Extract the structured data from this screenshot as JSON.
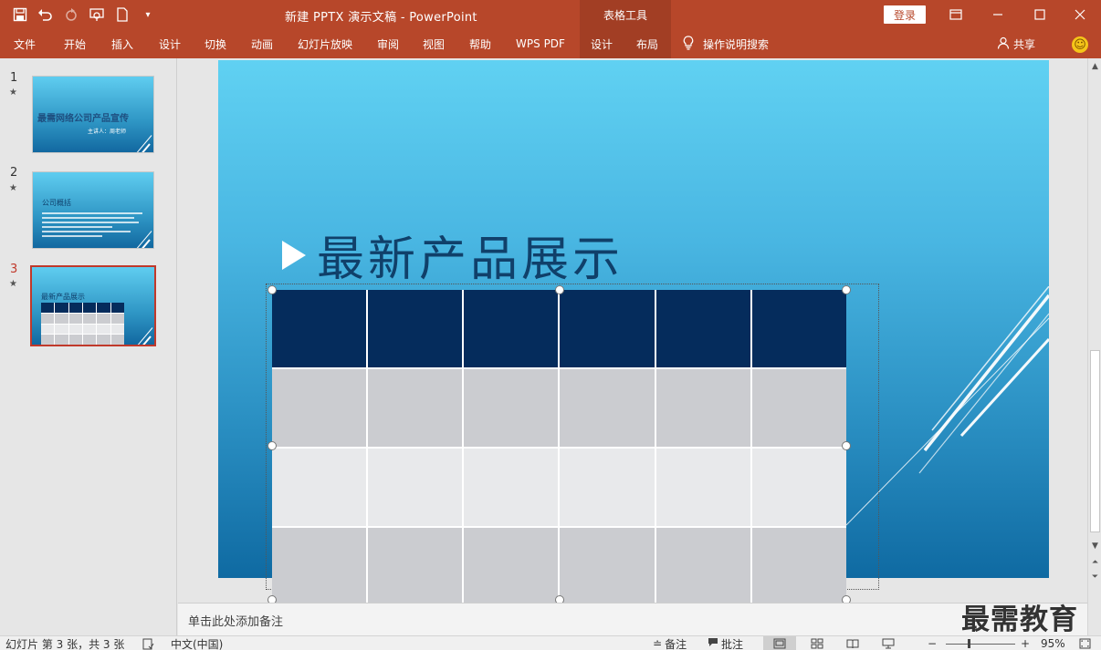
{
  "app": {
    "document_title": "新建 PPTX 演示文稿  -  PowerPoint",
    "context_tab_group": "表格工具",
    "login_label": "登录",
    "accent_color": "#b7472a"
  },
  "qat": {
    "icons": [
      "save-icon",
      "undo-icon",
      "redo-icon",
      "present-icon",
      "new-doc-icon",
      "customize-icon"
    ]
  },
  "ribbon": {
    "tabs": [
      "文件",
      "开始",
      "插入",
      "设计",
      "切换",
      "动画",
      "幻灯片放映",
      "审阅",
      "视图",
      "帮助",
      "WPS PDF",
      "设计",
      "布局"
    ],
    "tell_me": "操作说明搜索",
    "share": "共享"
  },
  "thumbnails": [
    {
      "num": "1",
      "title": "最需网络公司产品宣传",
      "subtitle": "主讲人：周老师"
    },
    {
      "num": "2",
      "title": "公司概括"
    },
    {
      "num": "3",
      "title": "最新产品展示"
    }
  ],
  "slide": {
    "title": "最新产品展示",
    "table": {
      "columns": 6,
      "rows": 4
    }
  },
  "notes": {
    "placeholder": "单击此处添加备注"
  },
  "watermark": "最需教育",
  "status": {
    "slide_info": "幻灯片 第 3 张，共 3 张",
    "language": "中文(中国)",
    "notes_btn": "备注",
    "comments_btn": "批注",
    "zoom_minus": "−",
    "zoom_plus": "+",
    "zoom_value": "95%"
  }
}
